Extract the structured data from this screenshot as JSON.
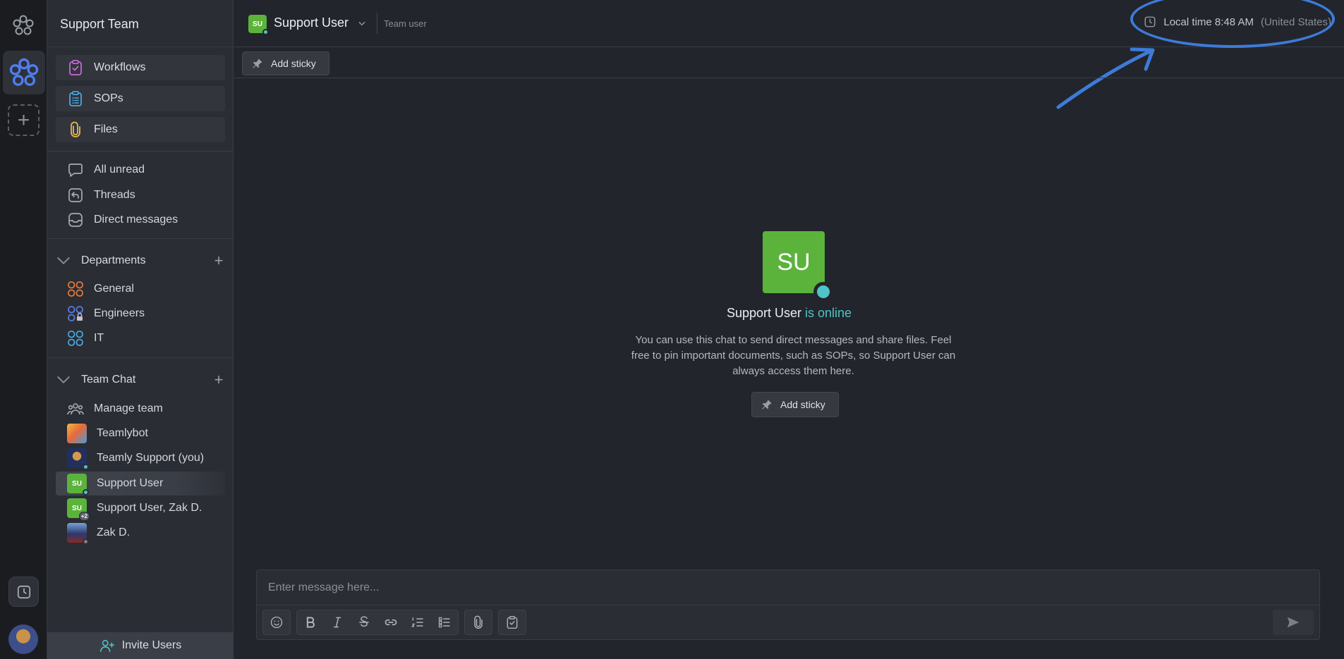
{
  "workspace": {
    "name": "Support Team"
  },
  "pinned": [
    {
      "label": "Workflows",
      "icon": "clipboard-check-icon",
      "color": "#c46ad8"
    },
    {
      "label": "SOPs",
      "icon": "clipboard-list-icon",
      "color": "#4aa6e0"
    },
    {
      "label": "Files",
      "icon": "paperclip-icon",
      "color": "#e8b84a"
    }
  ],
  "nav": [
    {
      "label": "All unread",
      "icon": "chat-bubble-icon"
    },
    {
      "label": "Threads",
      "icon": "reply-icon"
    },
    {
      "label": "Direct messages",
      "icon": "inbox-icon"
    }
  ],
  "departments": {
    "title": "Departments",
    "items": [
      {
        "label": "General",
        "color": "#e07a3e"
      },
      {
        "label": "Engineers",
        "color": "#5a7ae0"
      },
      {
        "label": "IT",
        "color": "#4aa6e0"
      }
    ]
  },
  "team_chat": {
    "title": "Team Chat",
    "manage": "Manage team",
    "items": [
      {
        "label": "Teamlybot"
      },
      {
        "label": "Teamly Support (you)"
      },
      {
        "label": "Support User",
        "initials": "SU"
      },
      {
        "label": "Support User, Zak D.",
        "initials": "SU",
        "extra": "+2"
      },
      {
        "label": "Zak D."
      }
    ]
  },
  "invite": "Invite Users",
  "header": {
    "initials": "SU",
    "name": "Support User",
    "role": "Team user",
    "local_time_label": "Local time 8:48 AM",
    "local_time_country": "(United States)"
  },
  "toolbar": {
    "add_sticky": "Add sticky"
  },
  "empty_state": {
    "initials": "SU",
    "name": "Support User",
    "status": "is online",
    "description": "You can use this chat to send direct messages and share files. Feel free to pin important documents, such as SOPs, so Support User can always access them here.",
    "add_sticky": "Add sticky"
  },
  "composer": {
    "placeholder": "Enter message here..."
  },
  "colors": {
    "accent_online": "#4fc3c7",
    "avatar_green": "#5bb33c",
    "annotation_blue": "#3d7bd9"
  }
}
